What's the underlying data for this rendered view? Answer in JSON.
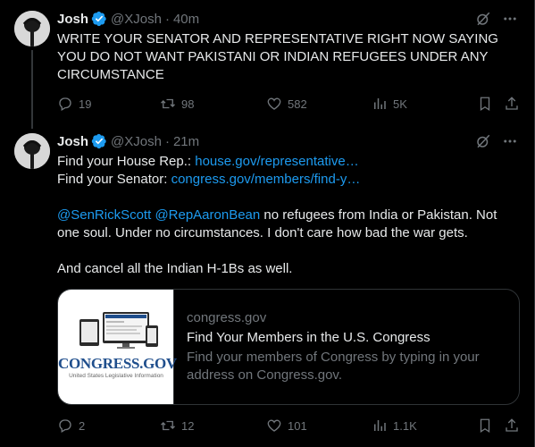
{
  "tweets": [
    {
      "name": "Josh",
      "handle": "@XJosh",
      "dot": "·",
      "time": "40m",
      "text": "WRITE YOUR SENATOR AND REPRESENTATIVE RIGHT NOW SAYING YOU DO NOT WANT PAKISTANI OR INDIAN REFUGEES UNDER ANY CIRCUMSTANCE",
      "replies": "19",
      "retweets": "98",
      "likes": "582",
      "views": "5K"
    },
    {
      "name": "Josh",
      "handle": "@XJosh",
      "dot": "·",
      "time": "21m",
      "line1_prefix": "Find your House Rep.: ",
      "line1_link": "house.gov/representative…",
      "line2_prefix": "Find your Senator: ",
      "line2_link": "congress.gov/members/find-y…",
      "mention1": "@SenRickScott",
      "mention2": "@RepAaronBean",
      "body_rest": " no refugees from India or Pakistan. Not one soul. Under no circumstances. I don't care how bad the war gets.",
      "closing": "And cancel all the Indian H-1Bs as well.",
      "card": {
        "domain": "congress.gov",
        "title": "Find Your Members in the U.S. Congress",
        "description": "Find your members of Congress by typing in your address on Congress.gov.",
        "logo_text": "CONGRESS.GOV",
        "logo_subtext": "United States Legislative Information"
      },
      "replies": "2",
      "retweets": "12",
      "likes": "101",
      "views": "1.1K"
    }
  ],
  "colors": {
    "background": "#000000",
    "text": "#e7e9ea",
    "muted": "#71767b",
    "link": "#1d9bf0",
    "verified": "#1d9bf0"
  },
  "icons": [
    "verified-badge-icon",
    "grok-icon",
    "more-icon",
    "reply-icon",
    "retweet-icon",
    "like-icon",
    "views-icon",
    "bookmark-icon",
    "share-icon"
  ]
}
